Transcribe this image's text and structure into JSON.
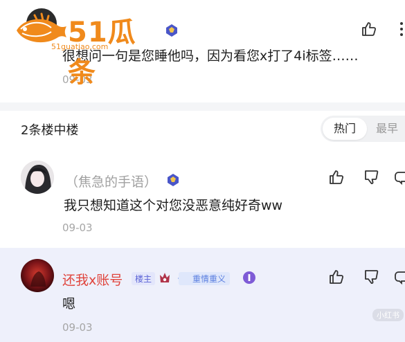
{
  "watermark": {
    "brand": "51瓜条",
    "url": "51guatiao.com"
  },
  "top_comment": {
    "text": "很想问一句是您睡他吗，因为看您x打了4i标签……",
    "date": "09-03"
  },
  "thread": {
    "title": "2条楼中楼",
    "sort_options": {
      "hot": "热门",
      "latest": "最早"
    }
  },
  "replies": [
    {
      "name": "（焦急的手语）",
      "text": "我只想知道这个对您没恶意纯好奇ww",
      "date": "09-03"
    },
    {
      "name": "还我x账号",
      "tag_owner": "楼主",
      "tag_level_num": "4",
      "tag_level": "重情重义",
      "text": "嗯",
      "date": "09-03"
    }
  ],
  "corner_watermark": "小红书",
  "colors": {
    "brand_orange": "#f08a1c",
    "owner_name": "#e0443c",
    "highlight_bg": "#eef0fb"
  },
  "icons": [
    "thumb-up-icon",
    "thumb-down-icon",
    "reply-icon",
    "more-icon",
    "rank-badge-icon"
  ]
}
